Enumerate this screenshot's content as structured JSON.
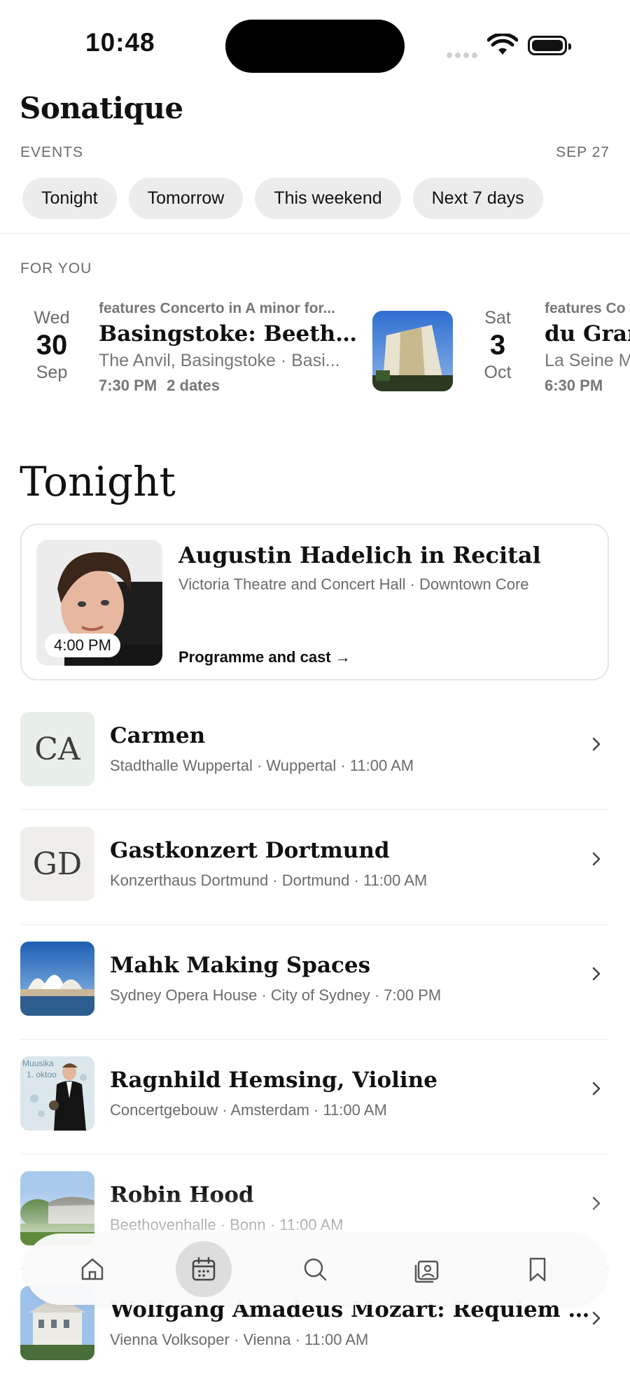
{
  "status_bar": {
    "time": "10:48"
  },
  "app": {
    "name": "Sonatique"
  },
  "header": {
    "section": "EVENTS",
    "date": "SEP 27"
  },
  "filters": [
    "Tonight",
    "Tomorrow",
    "This weekend",
    "Next 7 days"
  ],
  "for_you": {
    "label": "FOR YOU",
    "cards": [
      {
        "dow": "Wed",
        "day": "30",
        "month": "Sep",
        "features": "features Concerto in A minor for...",
        "title": "Basingstoke: Beethoven...",
        "venue": "The Anvil, Basingstoke · Basi...",
        "time": "7:30 PM",
        "dates": "2 dates"
      },
      {
        "dow": "Sat",
        "day": "3",
        "month": "Oct",
        "features": "features Co",
        "title": "du Grand",
        "venue": "La Seine M",
        "time": "6:30 PM"
      }
    ]
  },
  "tonight": {
    "heading": "Tonight",
    "featured": {
      "title": "Augustin Hadelich in Recital",
      "venue": "Victoria Theatre and Concert Hall · Downtown Core",
      "time": "4:00 PM",
      "link": "Programme and cast →"
    },
    "events": [
      {
        "initials": "CA",
        "title": "Carmen",
        "subtitle": "Stadthalle Wuppertal · Wuppertal · 11:00 AM",
        "thumb_color": "#e8efe9",
        "thumb": "initials"
      },
      {
        "initials": "GD",
        "title": "Gastkonzert Dortmund",
        "subtitle": "Konzerthaus Dortmund · Dortmund · 11:00 AM",
        "thumb_color": "#efeeea",
        "thumb": "initials"
      },
      {
        "title": "Mahk Making Spaces",
        "subtitle": "Sydney Opera House · City of Sydney · 7:00 PM",
        "thumb": "opera-house-photo"
      },
      {
        "title": "Ragnhild Hemsing, Violine",
        "subtitle": "Concertgebouw · Amsterdam · 11:00 AM",
        "thumb": "portrait-photo",
        "thumb_text": [
          "Muusika",
          "1. oktoo"
        ]
      },
      {
        "title": "Robin Hood",
        "subtitle": "Beethovenhalle · Bonn · 11:00 AM",
        "thumb": "hall-photo"
      },
      {
        "title": "Wolfgang Amadeus Mozart: Requiem in d-Moll...",
        "subtitle": "Vienna Volksoper · Vienna · 11:00 AM",
        "thumb": "building-photo"
      }
    ]
  },
  "tabbar": {
    "items": [
      {
        "name": "home",
        "icon": "home-icon"
      },
      {
        "name": "calendar",
        "icon": "calendar-icon",
        "active": true
      },
      {
        "name": "search",
        "icon": "search-icon"
      },
      {
        "name": "gallery",
        "icon": "gallery-icon"
      },
      {
        "name": "saved",
        "icon": "bookmark-icon"
      }
    ]
  },
  "colors": {
    "chip_bg": "#ececec",
    "muted_text": "#6b6b6b",
    "active_tab_bg": "#dddddd"
  }
}
